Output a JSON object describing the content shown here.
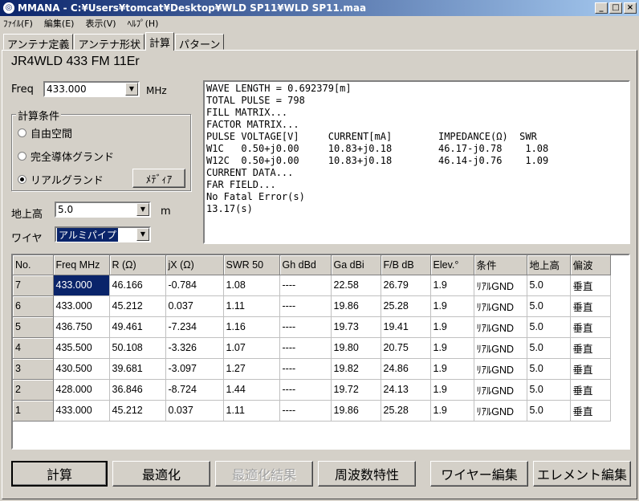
{
  "window": {
    "title": "MMANA - C:¥Users¥tomcat¥Desktop¥WLD SP11¥WLD SP11.maa",
    "min": "_",
    "max": "□",
    "close": "×"
  },
  "menu": [
    "ﾌｧｲﾙ(F)",
    "編集(E)",
    "表示(V)",
    "ﾍﾙﾌﾟ(H)"
  ],
  "tabs": [
    "アンテナ定義",
    "アンテナ形状",
    "計算",
    "パターン"
  ],
  "project_name": "JR4WLD 433 FM 11Er",
  "freq": {
    "label": "Freq",
    "value": "433.000",
    "unit": "MHz"
  },
  "calc_conditions": {
    "title": "計算条件",
    "options": [
      "自由空間",
      "完全導体グランド",
      "リアルグランド"
    ],
    "selected": 2,
    "media_button": "ﾒﾃﾞｨｱ"
  },
  "height": {
    "label": "地上高",
    "value": "5.0",
    "unit": "m"
  },
  "wire": {
    "label": "ワイヤ",
    "value": "アルミパイプ"
  },
  "output_lines": [
    "WAVE LENGTH = 0.692379[m]",
    "TOTAL PULSE = 798",
    "FILL MATRIX...",
    "FACTOR MATRIX...",
    "PULSE VOLTAGE[V]     CURRENT[mA]        IMPEDANCE(Ω)  SWR",
    "W1C   0.50+j0.00     10.83+j0.18        46.17-j0.78    1.08",
    "W12C  0.50+j0.00     10.83+j0.18        46.14-j0.76    1.09",
    "CURRENT DATA...",
    "FAR FIELD...",
    "No Fatal Error(s)",
    "13.17(s)"
  ],
  "table": {
    "columns": [
      "No.",
      "Freq MHz",
      "R (Ω)",
      "jX (Ω)",
      "SWR 50",
      "Gh dBd",
      "Ga dBi",
      "F/B dB",
      "Elev.°",
      "条件",
      "地上高",
      "偏波"
    ],
    "rows": [
      [
        "7",
        "433.000",
        "46.166",
        "-0.784",
        "1.08",
        "----",
        "22.58",
        "26.79",
        "1.9",
        "ﾘｱﾙGND",
        "5.0",
        "垂直"
      ],
      [
        "6",
        "433.000",
        "45.212",
        "0.037",
        "1.11",
        "----",
        "19.86",
        "25.28",
        "1.9",
        "ﾘｱﾙGND",
        "5.0",
        "垂直"
      ],
      [
        "5",
        "436.750",
        "49.461",
        "-7.234",
        "1.16",
        "----",
        "19.73",
        "19.41",
        "1.9",
        "ﾘｱﾙGND",
        "5.0",
        "垂直"
      ],
      [
        "4",
        "435.500",
        "50.108",
        "-3.326",
        "1.07",
        "----",
        "19.80",
        "20.75",
        "1.9",
        "ﾘｱﾙGND",
        "5.0",
        "垂直"
      ],
      [
        "3",
        "430.500",
        "39.681",
        "-3.097",
        "1.27",
        "----",
        "19.82",
        "24.86",
        "1.9",
        "ﾘｱﾙGND",
        "5.0",
        "垂直"
      ],
      [
        "2",
        "428.000",
        "36.846",
        "-8.724",
        "1.44",
        "----",
        "19.72",
        "24.13",
        "1.9",
        "ﾘｱﾙGND",
        "5.0",
        "垂直"
      ],
      [
        "1",
        "433.000",
        "45.212",
        "0.037",
        "1.11",
        "----",
        "19.86",
        "25.28",
        "1.9",
        "ﾘｱﾙGND",
        "5.0",
        "垂直"
      ]
    ]
  },
  "buttons": {
    "calc": "計算",
    "optimize": "最適化",
    "optimize_result": "最適化結果",
    "freq_char": "周波数特性",
    "wire_edit": "ワイヤー編集",
    "element_edit": "エレメント編集"
  }
}
